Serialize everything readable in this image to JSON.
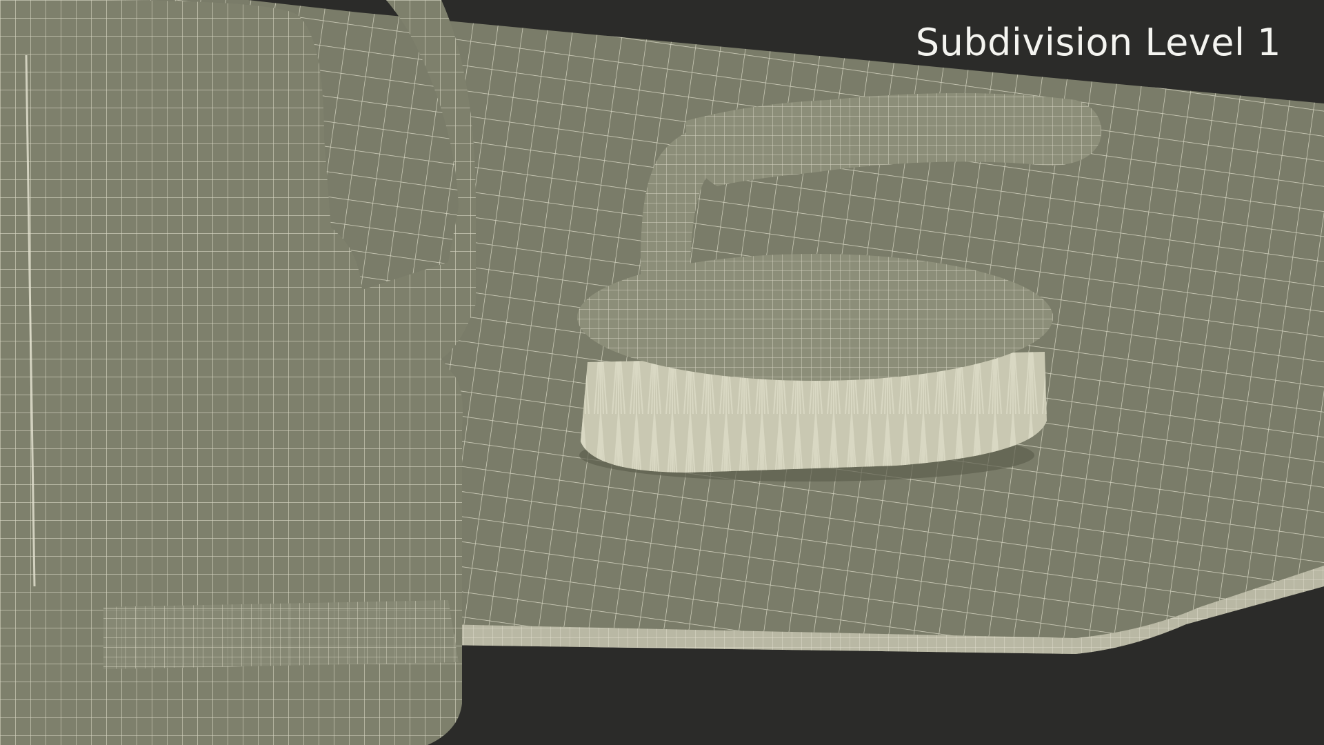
{
  "viewport": {
    "caption": "Subdivision Level 1"
  },
  "scene": {
    "background_color": "#2b2b29",
    "surface_color": "#7a7c69",
    "wire_color": "#e8e6d4",
    "objects": [
      "cutting-board",
      "detergent-bottle",
      "scrub-brush"
    ]
  }
}
